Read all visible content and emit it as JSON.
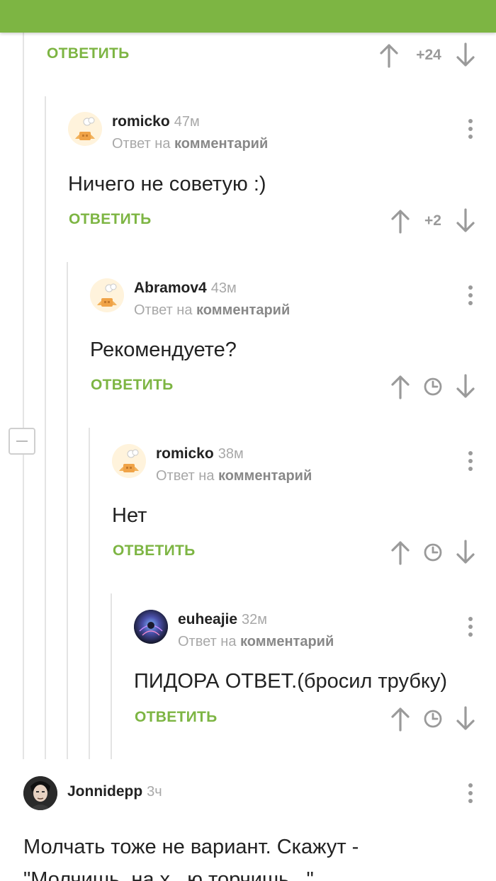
{
  "reply_label": "ОТВЕТИТЬ",
  "reply_to_prefix": "Ответ на",
  "reply_to_link": "комментарий",
  "top_actions": {
    "rating": "+24"
  },
  "comments": [
    {
      "user": "romicko",
      "time": "47м",
      "text": "Ничего не советую :)",
      "rating": "+2"
    },
    {
      "user": "Abramov4",
      "time": "43м",
      "text": "Рекомендуете?",
      "rating": ""
    },
    {
      "user": "romicko",
      "time": "38м",
      "text": "Нет",
      "rating": ""
    },
    {
      "user": "euheajie",
      "time": "32м",
      "text": "ПИДОРА ОТВЕТ.(бросил трубку)",
      "rating": ""
    },
    {
      "user": "Jonnidepp",
      "time": "3ч",
      "text_line1": "Молчать тоже не вариант. Скажут -",
      "text_line2": "\"Молчишь, на х...ю торчишь...\""
    }
  ],
  "colors": {
    "accent": "#7db543",
    "muted": "#a8a8a8",
    "thread_line": "#e4e4e4"
  },
  "icons": [
    "arrow-up-icon",
    "arrow-down-icon",
    "clock-icon",
    "more-vertical-icon",
    "collapse-icon"
  ]
}
